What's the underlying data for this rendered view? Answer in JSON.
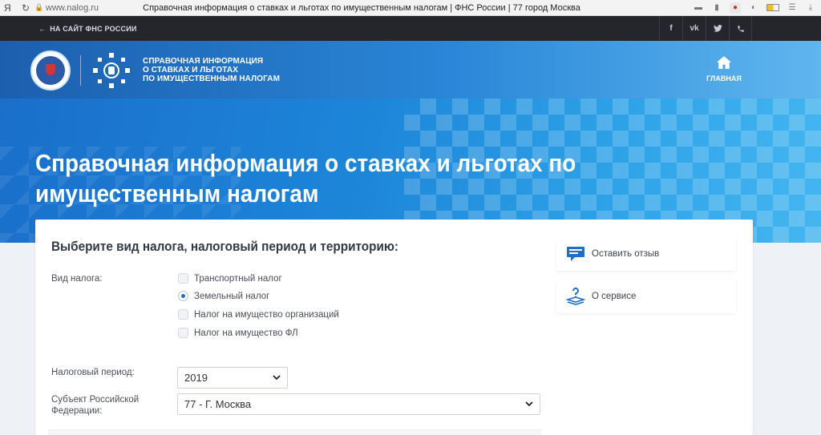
{
  "browser": {
    "ya_label": "Я",
    "url": "www.nalog.ru",
    "tab_title": "Справочная информация о ставках и льготах по имущественным налогам | ФНС России | 77 город Москва"
  },
  "topbar": {
    "back_link": "НА САЙТ ФНС РОССИИ",
    "social": [
      "f",
      "vk",
      "tw",
      "phone"
    ]
  },
  "header": {
    "title_lines": [
      "СПРАВОЧНАЯ ИНФОРМАЦИЯ",
      "О СТАВКАХ И ЛЬГОТАХ",
      "ПО ИМУЩЕСТВЕННЫМ НАЛОГАМ"
    ],
    "home_label": "ГЛАВНАЯ"
  },
  "hero": {
    "title": "Справочная информация о ставках и льготах по имущественным налогам"
  },
  "form": {
    "heading": "Выберите вид налога, налоговый период и территорию:",
    "tax_type_label": "Вид налога:",
    "tax_types": [
      {
        "label": "Транспортный налог",
        "selected": false
      },
      {
        "label": "Земельный налог",
        "selected": true
      },
      {
        "label": "Налог на имущество организаций",
        "selected": false
      },
      {
        "label": "Налог на имущество ФЛ",
        "selected": false
      }
    ],
    "period_label": "Налоговый период:",
    "period_value": "2019",
    "region_label_lines": [
      "Субъект Российской",
      "Федерации:"
    ],
    "region_value": "77 - Г. Москва"
  },
  "side": {
    "feedback_label": "Оставить отзыв",
    "about_label": "О сервисе"
  },
  "colors": {
    "accent": "#1f6ec9",
    "topbar": "#24262b"
  }
}
